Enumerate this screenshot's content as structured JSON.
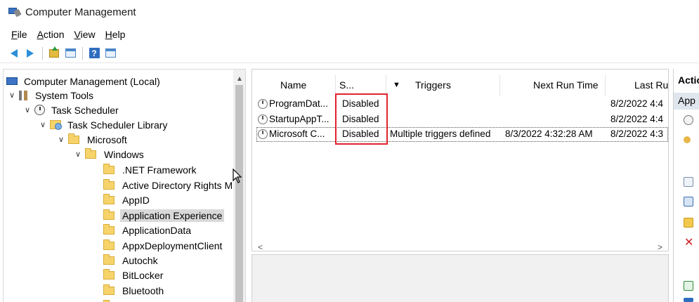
{
  "window": {
    "title": "Computer Management"
  },
  "menu": [
    {
      "label": "File",
      "underline": "F",
      "rest": "ile"
    },
    {
      "label": "Action",
      "underline": "A",
      "rest": "ction"
    },
    {
      "label": "View",
      "underline": "V",
      "rest": "iew"
    },
    {
      "label": "Help",
      "underline": "H",
      "rest": "elp"
    }
  ],
  "toolbar": {
    "help_glyph": "?"
  },
  "tree": {
    "items": [
      {
        "label": "Computer Management (Local)"
      },
      {
        "label": "System Tools"
      },
      {
        "label": "Task Scheduler"
      },
      {
        "label": "Task Scheduler Library"
      },
      {
        "label": "Microsoft"
      },
      {
        "label": "Windows"
      },
      {
        "label": ".NET Framework"
      },
      {
        "label": "Active Directory Rights M"
      },
      {
        "label": "AppID"
      },
      {
        "label": "Application Experience"
      },
      {
        "label": "ApplicationData"
      },
      {
        "label": "AppxDeploymentClient"
      },
      {
        "label": "Autochk"
      },
      {
        "label": "BitLocker"
      },
      {
        "label": "Bluetooth"
      }
    ],
    "selected": "Application Experience"
  },
  "task_list": {
    "columns": [
      "Name",
      "S...",
      "Triggers",
      "Next Run Time",
      "Last Ru"
    ],
    "sort_glyph": "▼",
    "rows": [
      {
        "name": "ProgramDat...",
        "status": "Disabled",
        "triggers": "",
        "next_run": "",
        "last_run": "8/2/2022 4:4"
      },
      {
        "name": "StartupAppT...",
        "status": "Disabled",
        "triggers": "",
        "next_run": "",
        "last_run": "8/2/2022 4:4"
      },
      {
        "name": "Microsoft C...",
        "status": "Disabled",
        "triggers": "Multiple triggers defined",
        "next_run": "8/3/2022 4:32:28 AM",
        "last_run": "8/2/2022 4:3"
      }
    ],
    "scroll_left": "<",
    "scroll_right": ">"
  },
  "actions": {
    "header": "Actio",
    "subheader": "App",
    "delete_glyph": "✕"
  },
  "colors": {
    "highlight_box": "#e0242d",
    "selected_row": "#d9d9d9",
    "actions_sub_bg": "#dfe6ee"
  }
}
